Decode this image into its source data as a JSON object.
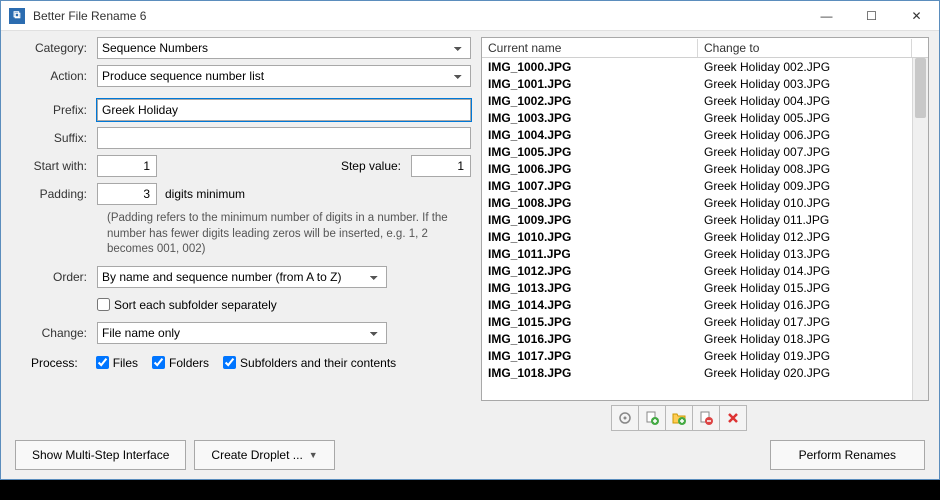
{
  "window": {
    "title": "Better File Rename 6"
  },
  "form": {
    "category_label": "Category:",
    "category_value": "Sequence Numbers",
    "action_label": "Action:",
    "action_value": "Produce sequence number list",
    "prefix_label": "Prefix:",
    "prefix_value": "Greek Holiday ",
    "suffix_label": "Suffix:",
    "suffix_value": "",
    "startwith_label": "Start with:",
    "startwith_value": "1",
    "stepvalue_label": "Step value:",
    "stepvalue_value": "1",
    "padding_label": "Padding:",
    "padding_value": "3",
    "digits_min": "digits minimum",
    "padding_help": "(Padding refers to the minimum number of digits in a number. If the number has fewer digits leading zeros will be inserted, e.g. 1, 2 becomes 001, 002)",
    "order_label": "Order:",
    "order_value": "By name and sequence number (from A to Z)",
    "sort_subfolder": "Sort each subfolder separately",
    "change_label": "Change:",
    "change_value": "File name only"
  },
  "process": {
    "label": "Process:",
    "files": "Files",
    "folders": "Folders",
    "subfolders": "Subfolders and their contents"
  },
  "filelist": {
    "col_current": "Current name",
    "col_changeto": "Change to",
    "rows": [
      {
        "current": "IMG_1000.JPG",
        "changeto": "Greek Holiday 002.JPG"
      },
      {
        "current": "IMG_1001.JPG",
        "changeto": "Greek Holiday 003.JPG"
      },
      {
        "current": "IMG_1002.JPG",
        "changeto": "Greek Holiday 004.JPG"
      },
      {
        "current": "IMG_1003.JPG",
        "changeto": "Greek Holiday 005.JPG"
      },
      {
        "current": "IMG_1004.JPG",
        "changeto": "Greek Holiday 006.JPG"
      },
      {
        "current": "IMG_1005.JPG",
        "changeto": "Greek Holiday 007.JPG"
      },
      {
        "current": "IMG_1006.JPG",
        "changeto": "Greek Holiday 008.JPG"
      },
      {
        "current": "IMG_1007.JPG",
        "changeto": "Greek Holiday 009.JPG"
      },
      {
        "current": "IMG_1008.JPG",
        "changeto": "Greek Holiday 010.JPG"
      },
      {
        "current": "IMG_1009.JPG",
        "changeto": "Greek Holiday 011.JPG"
      },
      {
        "current": "IMG_1010.JPG",
        "changeto": "Greek Holiday 012.JPG"
      },
      {
        "current": "IMG_1011.JPG",
        "changeto": "Greek Holiday 013.JPG"
      },
      {
        "current": "IMG_1012.JPG",
        "changeto": "Greek Holiday 014.JPG"
      },
      {
        "current": "IMG_1013.JPG",
        "changeto": "Greek Holiday 015.JPG"
      },
      {
        "current": "IMG_1014.JPG",
        "changeto": "Greek Holiday 016.JPG"
      },
      {
        "current": "IMG_1015.JPG",
        "changeto": "Greek Holiday 017.JPG"
      },
      {
        "current": "IMG_1016.JPG",
        "changeto": "Greek Holiday 018.JPG"
      },
      {
        "current": "IMG_1017.JPG",
        "changeto": "Greek Holiday 019.JPG"
      },
      {
        "current": "IMG_1018.JPG",
        "changeto": "Greek Holiday 020.JPG"
      }
    ]
  },
  "buttons": {
    "show_multistep": "Show Multi-Step Interface",
    "create_droplet": "Create Droplet ...",
    "perform": "Perform Renames"
  }
}
